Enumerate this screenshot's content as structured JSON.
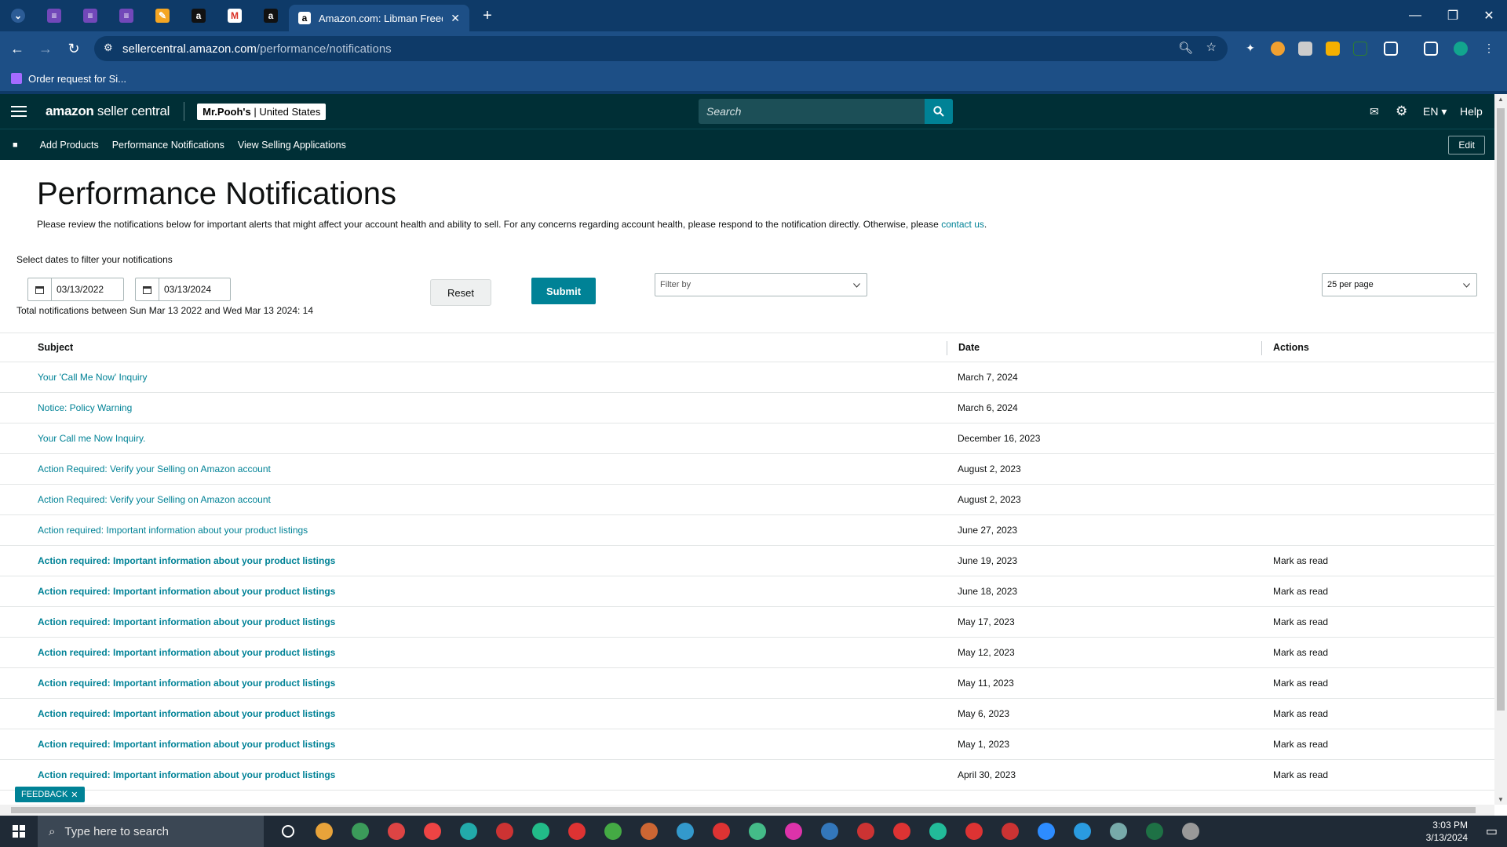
{
  "browser": {
    "active_tab_title": "Amazon.com: Libman Freedom",
    "url_host": "sellercentral.amazon.com",
    "url_path": "/performance/notifications",
    "bookmark": "Order request for Si..."
  },
  "header": {
    "logo_main": "amazon",
    "logo_sub": " seller central",
    "store_name": "Mr.Pooh's",
    "store_region": " | United States",
    "search_placeholder": "Search",
    "language": "EN",
    "help": "Help"
  },
  "subnav": {
    "items": [
      "Add Products",
      "Performance Notifications",
      "View Selling Applications"
    ],
    "edit": "Edit"
  },
  "page": {
    "title": "Performance Notifications",
    "description": "Please review the notifications below for important alerts that might affect your account health and ability to sell. For any concerns regarding account health, please respond to the notification directly. Otherwise, please ",
    "contact_link": "contact us",
    "description_end": ".",
    "filter_label": "Select dates to filter your notifications",
    "start_date": "03/13/2022",
    "end_date": "03/13/2024",
    "reset": "Reset",
    "submit": "Submit",
    "filter_placeholder": "Filter by",
    "per_page": "25 per page",
    "total": "Total notifications between Sun Mar 13 2022 and Wed Mar 13 2024: 14"
  },
  "table": {
    "headers": {
      "subject": "Subject",
      "date": "Date",
      "actions": "Actions"
    },
    "rows": [
      {
        "subject": "Your 'Call Me Now' Inquiry",
        "date": "March 7, 2024",
        "action": ""
      },
      {
        "subject": "Notice: Policy Warning",
        "date": "March 6, 2024",
        "action": ""
      },
      {
        "subject": "Your Call me Now Inquiry.",
        "date": "December 16, 2023",
        "action": ""
      },
      {
        "subject": "Action Required: Verify your Selling on Amazon account",
        "date": "August 2, 2023",
        "action": ""
      },
      {
        "subject": "Action Required: Verify your Selling on Amazon account",
        "date": "August 2, 2023",
        "action": ""
      },
      {
        "subject": "Action required: Important information about your product listings",
        "date": "June 27, 2023",
        "action": ""
      },
      {
        "subject": "Action required: Important information about your product listings",
        "date": "June 19, 2023",
        "action": "Mark as read"
      },
      {
        "subject": "Action required: Important information about your product listings",
        "date": "June 18, 2023",
        "action": "Mark as read"
      },
      {
        "subject": "Action required: Important information about your product listings",
        "date": "May 17, 2023",
        "action": "Mark as read"
      },
      {
        "subject": "Action required: Important information about your product listings",
        "date": "May 12, 2023",
        "action": "Mark as read"
      },
      {
        "subject": "Action required: Important information about your product listings",
        "date": "May 11, 2023",
        "action": "Mark as read"
      },
      {
        "subject": "Action required: Important information about your product listings",
        "date": "May 6, 2023",
        "action": "Mark as read"
      },
      {
        "subject": "Action required: Important information about your product listings",
        "date": "May 1, 2023",
        "action": "Mark as read"
      },
      {
        "subject": "Action required: Important information about your product listings",
        "date": "April 30, 2023",
        "action": "Mark as read"
      }
    ]
  },
  "feedback": "FEEDBACK",
  "taskbar": {
    "search_placeholder": "Type here to search",
    "time": "3:03 PM",
    "date": "3/13/2024"
  },
  "colors": {
    "teal": "#008296",
    "header_bg": "#002f36",
    "chrome": "#1d4f86"
  }
}
